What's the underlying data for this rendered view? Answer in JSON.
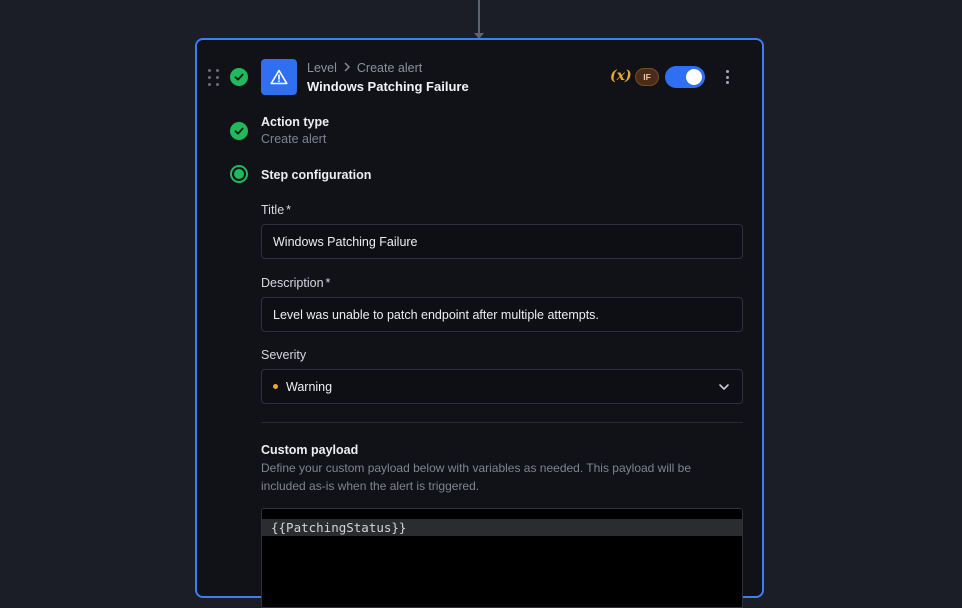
{
  "card": {
    "breadcrumb": {
      "parent": "Level",
      "separator": "chevron-right-icon",
      "child": "Create alert"
    },
    "title": "Windows Patching Failure",
    "variables_label": "(x)",
    "condition_badge": "IF",
    "enabled": true
  },
  "steps": {
    "action_type": {
      "title": "Action type",
      "value": "Create alert",
      "status": "complete"
    },
    "configuration": {
      "title": "Step configuration",
      "status": "active"
    }
  },
  "form": {
    "title_label": "Title",
    "title_required": "*",
    "title_value": "Windows Patching Failure",
    "description_label": "Description",
    "description_required": "*",
    "description_value": "Level was unable to patch endpoint after multiple attempts.",
    "severity_label": "Severity",
    "severity_value": "Warning",
    "severity_color": "#e9a92b"
  },
  "payload": {
    "title": "Custom payload",
    "description": "Define your custom payload below with variables as needed. This payload will be included as-is when the alert is triggered.",
    "code": "{{PatchingStatus}}"
  },
  "colors": {
    "accent": "#2f6ff0",
    "success": "#1fba5d",
    "background": "#1c1e27",
    "card": "#101218"
  }
}
